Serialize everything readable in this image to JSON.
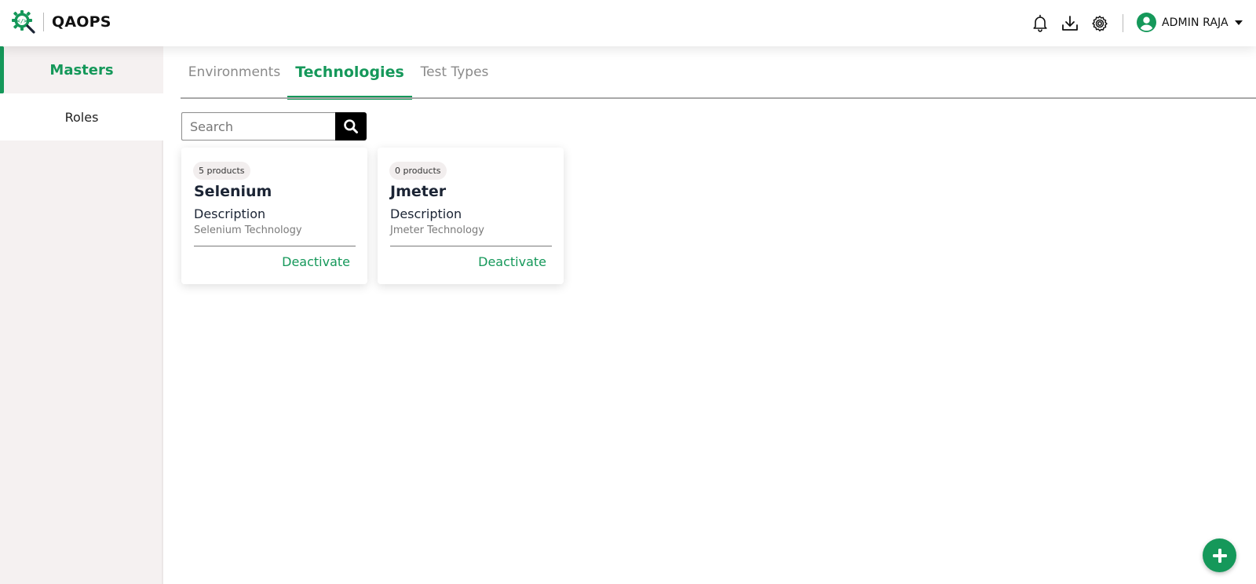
{
  "app": {
    "name": "QAOPS",
    "logo_icon": "gear-code-magnifier-icon"
  },
  "header": {
    "icons": [
      "bell-icon",
      "download-icon",
      "settings-icon"
    ],
    "user": {
      "name": "ADMIN RAJA",
      "avatar_icon": "user-circle-icon",
      "caret_icon": "caret-down-icon"
    }
  },
  "sidebar": {
    "items": [
      {
        "label": "Masters",
        "active": true
      },
      {
        "label": "Roles",
        "active": false
      }
    ]
  },
  "tabs": [
    {
      "label": "Environments",
      "active": false
    },
    {
      "label": "Technologies",
      "active": true
    },
    {
      "label": "Test Types",
      "active": false
    }
  ],
  "search": {
    "placeholder": "Search",
    "value": ""
  },
  "cards": [
    {
      "badge": "5 products",
      "title": "Selenium",
      "description_heading": "Description",
      "description": "Selenium Technology",
      "action": "Deactivate"
    },
    {
      "badge": "0 products",
      "title": "Jmeter",
      "description_heading": "Description",
      "description": "Jmeter Technology",
      "action": "Deactivate"
    }
  ],
  "fab": {
    "icon": "plus-icon"
  },
  "colors": {
    "accent": "#15985a",
    "sidebar_bg": "#f5f1f1",
    "text_dark": "#1b2434",
    "muted": "#8a8a8a"
  }
}
